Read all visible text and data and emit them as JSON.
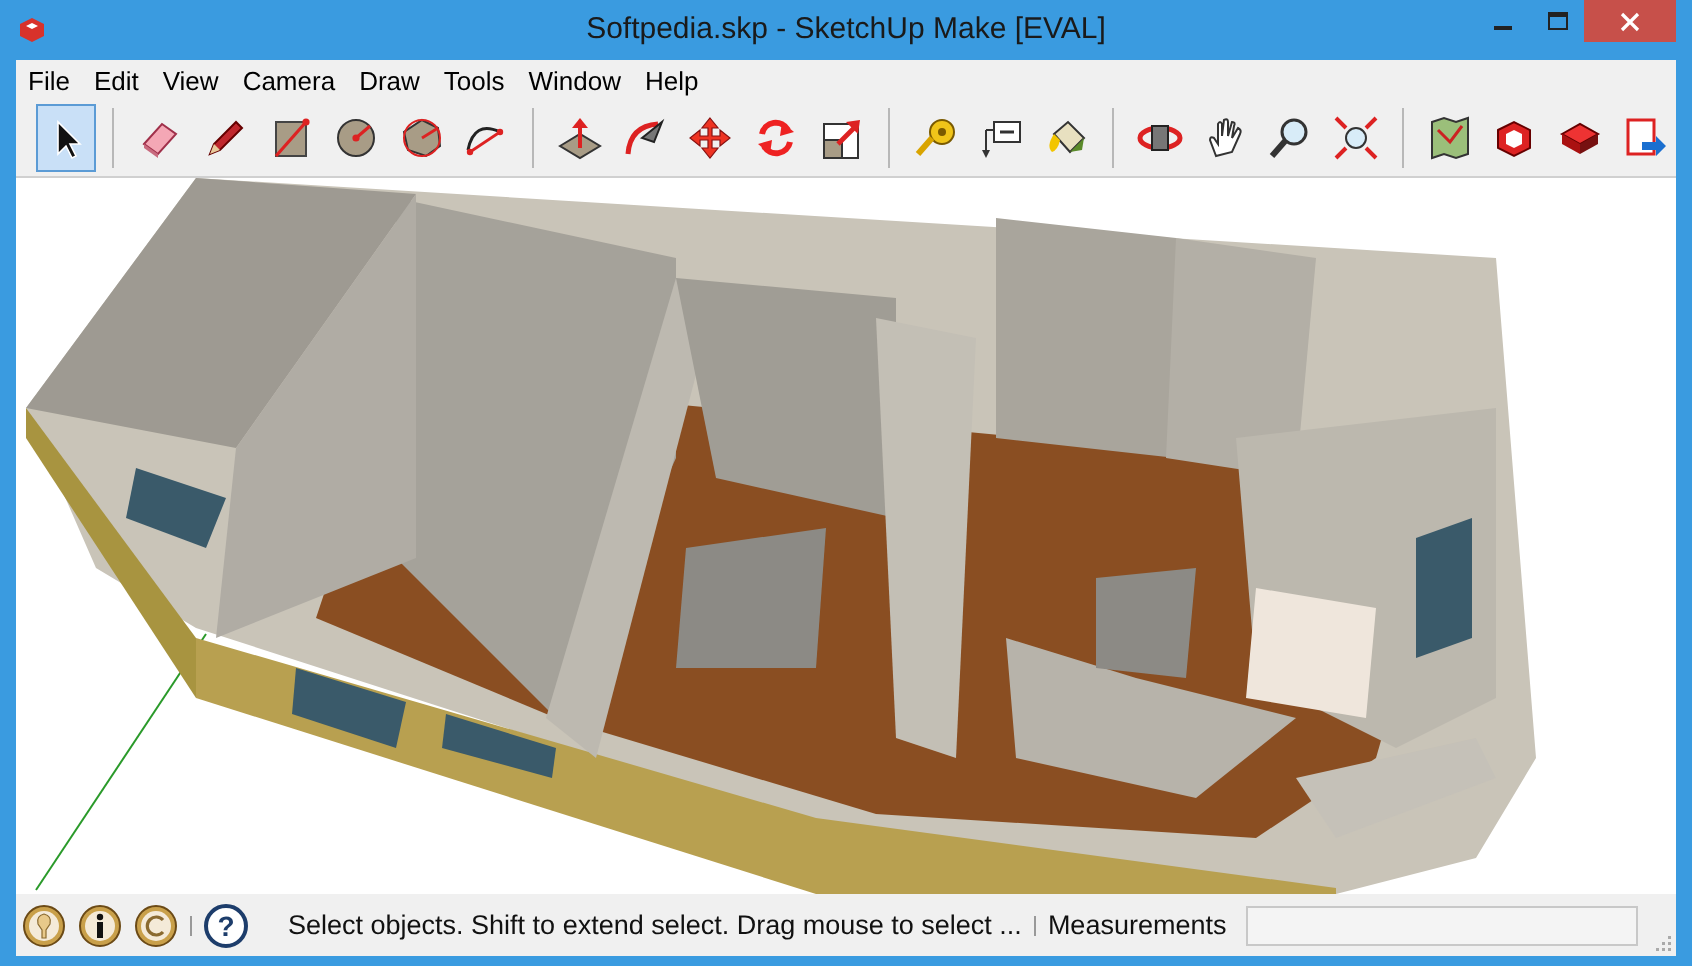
{
  "window": {
    "title": "Softpedia.skp - SketchUp Make [EVAL]"
  },
  "menu": [
    "File",
    "Edit",
    "View",
    "Camera",
    "Draw",
    "Tools",
    "Window",
    "Help"
  ],
  "toolbar": {
    "groups": [
      [
        {
          "selected": true
        }
      ],
      [
        {
          "selected": false
        },
        {
          "selected": false
        },
        {
          "selected": false
        },
        {
          "selected": false
        },
        {
          "selected": false
        },
        {
          "selected": false
        }
      ],
      [
        {
          "selected": false
        },
        {
          "selected": false
        },
        {
          "selected": false
        },
        {
          "selected": false
        },
        {
          "selected": false
        }
      ],
      [
        {
          "selected": false
        },
        {
          "selected": false
        },
        {
          "selected": false
        }
      ],
      [
        {
          "selected": false
        },
        {
          "selected": false
        },
        {
          "selected": false
        },
        {
          "selected": false
        }
      ],
      [
        {
          "selected": false
        },
        {
          "selected": false
        },
        {
          "selected": false
        },
        {
          "selected": false
        }
      ]
    ]
  },
  "status_bar": {
    "help": "?",
    "message": "Select objects. Shift to extend select. Drag mouse to select ...",
    "measurements_label": "Measurements"
  }
}
